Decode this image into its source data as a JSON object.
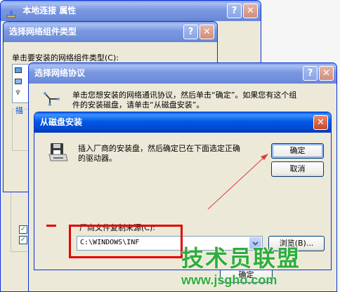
{
  "win1": {
    "title": "本地连接 属性"
  },
  "win2": {
    "title": "选择网络组件类型",
    "prompt": "单击要安装的网络组件类型(C):",
    "side_label": "描"
  },
  "win3": {
    "title": "选择网络协议",
    "desc_line1": "单击您想安装的网络通讯协议，然后单击“确定”。如果您有这个组",
    "desc_line2": "件的安装磁盘，请单击“从磁盘安装”。"
  },
  "win4": {
    "title": "从磁盘安装",
    "message_line1": "插入厂商的安装盘，然后确定已在下面选定正确",
    "message_line2": "的驱动器。",
    "ok_label": "确定",
    "cancel_label": "取消",
    "source_label": "厂商文件复制来源(C):",
    "source_value": "C:\\WINDOWS\\INF",
    "browse_label": "浏览(B)..."
  },
  "behind_button_label": "确定",
  "watermark": {
    "line1": "技术员联盟",
    "line2": "www.jsgho.com"
  },
  "colors": {
    "xp_blue": "#0a5ce5",
    "dialog_bg": "#ece9d8",
    "highlight_red": "#e00000",
    "watermark_green": "#2fae3b"
  }
}
